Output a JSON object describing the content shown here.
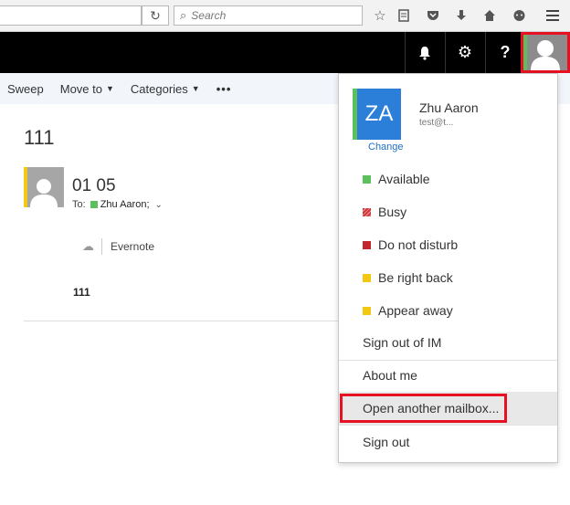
{
  "browser": {
    "search_placeholder": "Search",
    "icons": [
      "star-icon",
      "reading-list-icon",
      "pocket-icon",
      "download-icon",
      "home-icon",
      "chat-icon",
      "menu-icon"
    ]
  },
  "header": {
    "icons": [
      "bell-icon",
      "gear-icon",
      "help-icon",
      "avatar-icon"
    ],
    "help_label": "?"
  },
  "commandbar": {
    "sweep": "Sweep",
    "move_to": "Move to",
    "categories": "Categories",
    "more": "•••"
  },
  "message": {
    "subject": "111",
    "title": "01 05",
    "to_label": "To:",
    "recipient": "Zhu Aaron;",
    "addin": "Evernote",
    "body": "111"
  },
  "account": {
    "initials": "ZA",
    "name": "Zhu Aaron",
    "email": "test@t...",
    "change": "Change",
    "statuses": [
      {
        "label": "Available",
        "color": "#5cc05c"
      },
      {
        "label": "Busy",
        "color": "#d13438"
      },
      {
        "label": "Do not disturb",
        "color": "#c4262e"
      },
      {
        "label": "Be right back",
        "color": "#f2c811"
      },
      {
        "label": "Appear away",
        "color": "#f2c811"
      }
    ],
    "sign_out_im": "Sign out of IM",
    "about_me": "About me",
    "open_another": "Open another mailbox...",
    "sign_out": "Sign out"
  },
  "colors": {
    "accent": "#2b7fd9",
    "highlight": "#e81123",
    "header_bg": "#000000"
  }
}
